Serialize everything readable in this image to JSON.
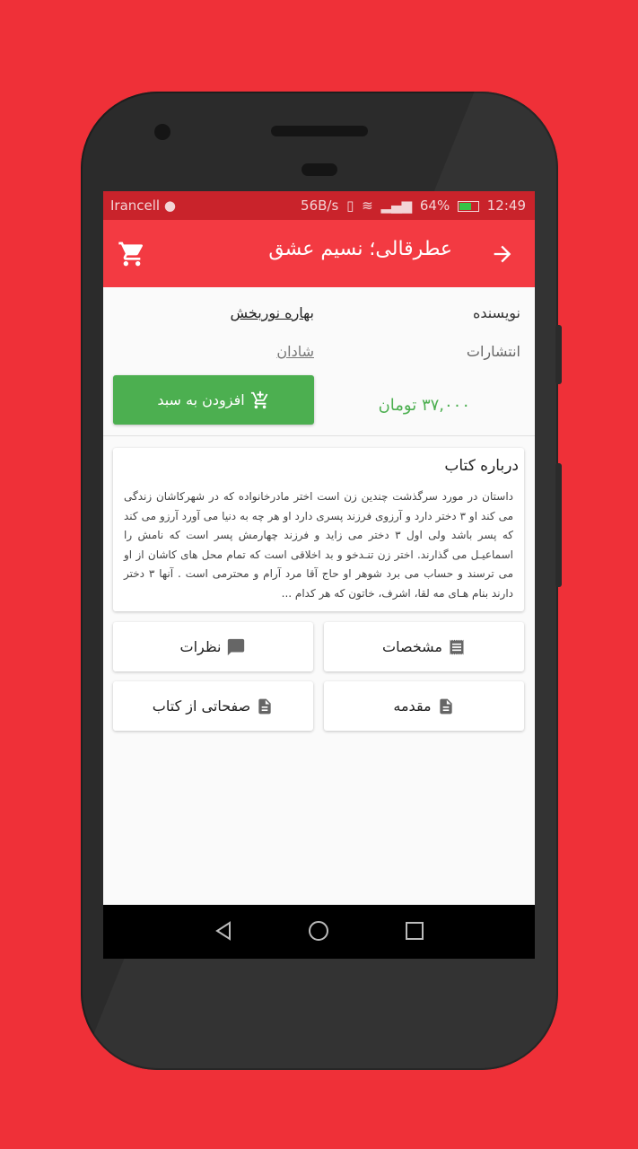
{
  "status_bar": {
    "carrier": "Irancell",
    "speed": "56B/s",
    "battery": "64%",
    "time": "12:49"
  },
  "app_bar": {
    "title": "عطرقالی؛ نسیم عشق",
    "back_icon": "arrow-right-icon",
    "cart_icon": "cart-icon"
  },
  "book": {
    "author_label": "نویسنده",
    "author": "بهاره نوربخش",
    "publisher_label": "انتشارات",
    "publisher": "شادان",
    "add_to_cart": "افزودن به سبد",
    "price": "۳۷,۰۰۰ تومان"
  },
  "about": {
    "heading": "درباره کتاب",
    "text": "داستان در مورد سرگذشت چندین زن است اختر مادرخانواده که در شهرکاشان زندگی می کند او ۳ دختر دارد و آرزوی فرزند پسری دارد او هر چه به دنیا می آورد آرزو می کند که پسر باشد ولی اول ۳ دختر می زاید و فرزند چهارمش پسر است که نامش را اسماعیـل می گذارند. اختر زن تنـدخو و بد اخلاقی است که تمام محل های کاشان از او می ترسند و حساب می برد شوهر او حاج آقا مرد آرام و محترمی است . آنها ۳ دختر دارند بنام هـای مه لقا، اشرف، خاتون که هر کدام ..."
  },
  "tiles": {
    "specs": "مشخصات",
    "comments": "نظرات",
    "intro": "مقدمه",
    "pages": "صفحاتی از کتاب"
  },
  "colors": {
    "background": "#ef3038",
    "app_bar": "#f33a42",
    "status_bar": "#c9232b",
    "accent_green": "#4caf50"
  }
}
